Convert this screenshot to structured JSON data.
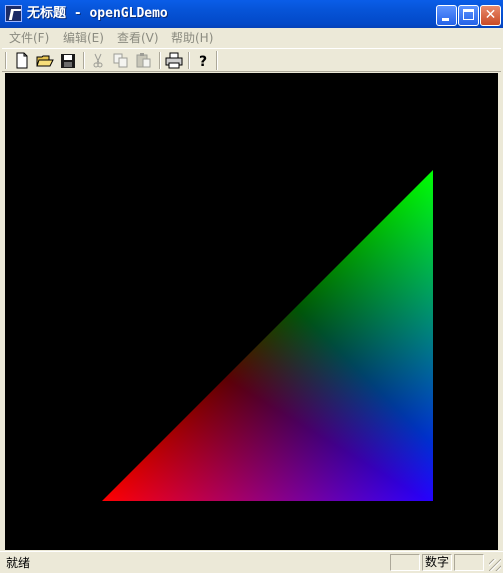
{
  "window": {
    "title": "无标题 - openGLDemo"
  },
  "menu": [
    {
      "label": "文件(F)"
    },
    {
      "label": "编辑(E)"
    },
    {
      "label": "查看(V)"
    },
    {
      "label": "帮助(H)"
    }
  ],
  "toolbar": {
    "tools": [
      "new-document",
      "open-folder",
      "save-disk",
      "cut-scissors",
      "copy",
      "paste",
      "print",
      "help"
    ]
  },
  "viewport": {
    "background": "#000000",
    "triangle": {
      "vertex_colors": {
        "bottom_left": "#ff0000",
        "top_right": "#00ff00",
        "bottom_right": "#0000ff"
      }
    }
  },
  "status": {
    "text": "就绪",
    "numlock": "数字"
  }
}
